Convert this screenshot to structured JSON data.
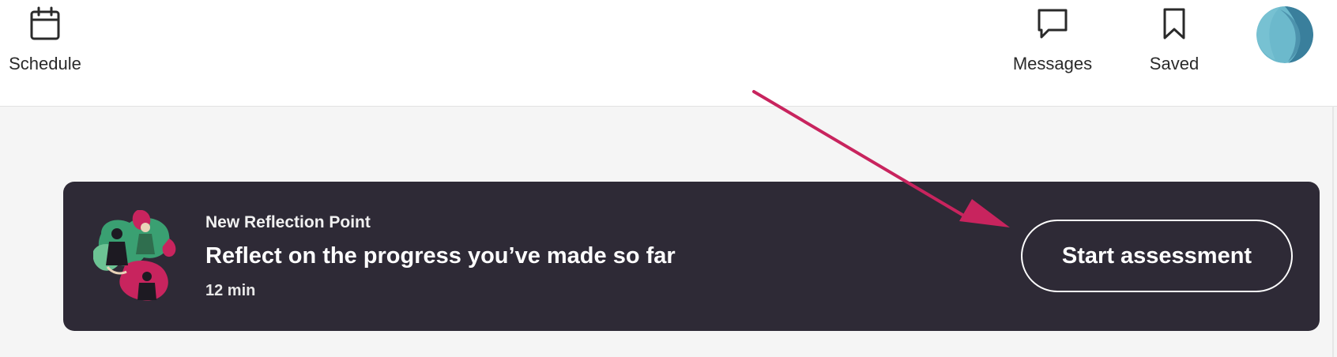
{
  "nav": {
    "schedule_label": "Schedule",
    "messages_label": "Messages",
    "saved_label": "Saved",
    "icons": {
      "schedule": "calendar-icon",
      "messages": "chat-bubble-icon",
      "saved": "bookmark-icon"
    }
  },
  "banner": {
    "eyebrow": "New Reflection Point",
    "title": "Reflect on the progress you’ve made so far",
    "duration": "12 min",
    "button_label": "Start assessment",
    "background_color": "#2e2a36"
  },
  "colors": {
    "annotation_arrow": "#c8245e",
    "avatar_primary": "#3f8fa8",
    "avatar_secondary": "#8fd0de"
  }
}
